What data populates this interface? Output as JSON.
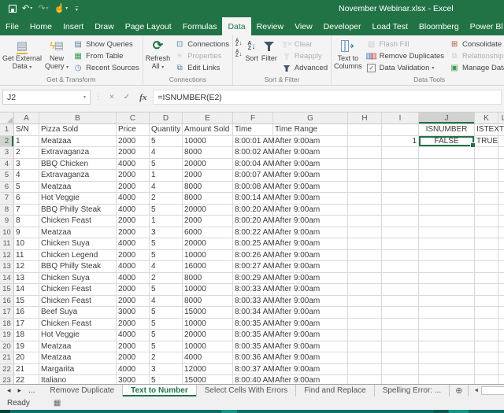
{
  "title_bar": {
    "title": "November Webinar.xlsx - Excel"
  },
  "icons": {
    "undo": "↶",
    "redo": "↷",
    "touch_mode": "☝",
    "caret_down": "▾",
    "letter_a": "A",
    "letter_z": "Z",
    "arrow_down": "↓",
    "get_external": "▤",
    "new_query_bolt": "ϟ",
    "new_query_table": "▤",
    "show_queries": "▤",
    "from_table": "▦",
    "recent_sources": "◷",
    "refresh": "⟳",
    "connections": "⊡",
    "properties": "≡",
    "edit_links": "⧉",
    "flash_fill": "▧",
    "remove_dup_a": "▥",
    "remove_dup_b": "▥",
    "check": "✓",
    "consolidate": "⊞",
    "relationships": "⧉",
    "manage_data_model": "▣",
    "cancel": "×",
    "enter": "✓",
    "fx": "fx",
    "ellipsis_v": "⋮",
    "nav_left": "◂",
    "nav_right": "▸",
    "tabs_more": "...",
    "add_sheet": "⊕",
    "scroll_left": "◄",
    "macro": "▦"
  },
  "ribbon_tabs": {
    "file": "File",
    "tabs": [
      "Home",
      "Insert",
      "Draw",
      "Page Layout",
      "Formulas",
      "Data",
      "Review",
      "View",
      "Developer",
      "Load Test",
      "Bloomberg",
      "Power Bl"
    ],
    "active": "Data"
  },
  "ribbon": {
    "groups": [
      {
        "label": "Get & Transform",
        "big": [
          {
            "name": "get-external-data",
            "line1": "Get External",
            "line2": "Data",
            "caret": true,
            "icon": "get_external"
          },
          {
            "name": "new-query",
            "line1": "New",
            "line2": "Query",
            "caret": true,
            "icon": "new_query"
          }
        ],
        "small": [
          {
            "name": "show-queries",
            "label": "Show Queries",
            "icon": "show_queries"
          },
          {
            "name": "from-table",
            "label": "From Table",
            "icon": "from_table"
          },
          {
            "name": "recent-sources",
            "label": "Recent Sources",
            "icon": "recent_sources"
          }
        ]
      },
      {
        "label": "Connections",
        "big": [
          {
            "name": "refresh-all",
            "line1": "Refresh",
            "line2": "All",
            "caret": true,
            "icon": "refresh"
          }
        ],
        "small": [
          {
            "name": "connections",
            "label": "Connections",
            "icon": "connections"
          },
          {
            "name": "properties",
            "label": "Properties",
            "icon": "properties",
            "disabled": true
          },
          {
            "name": "edit-links",
            "label": "Edit Links",
            "icon": "edit_links"
          }
        ]
      },
      {
        "label": "Sort & Filter",
        "az": true,
        "big": [
          {
            "name": "sort",
            "line1": "Sort",
            "icon": "sort_big"
          },
          {
            "name": "filter",
            "line1": "Filter",
            "icon": "funnel"
          }
        ],
        "small": [
          {
            "name": "clear-filter",
            "label": "Clear",
            "icon": "funnel_x",
            "disabled": true
          },
          {
            "name": "reapply-filter",
            "label": "Reapply",
            "icon": "funnel_r",
            "disabled": true
          },
          {
            "name": "advanced-filter",
            "label": "Advanced",
            "icon": "funnel_a"
          }
        ]
      },
      {
        "label": "Data Tools",
        "big": [
          {
            "name": "text-to-columns",
            "line1": "Text to",
            "line2": "Columns",
            "icon": "ttc"
          }
        ],
        "small": [
          {
            "name": "flash-fill",
            "label": "Flash Fill",
            "icon": "flash_fill",
            "disabled": true
          },
          {
            "name": "remove-duplicates",
            "label": "Remove Duplicates",
            "icon": "remove_duplicates"
          },
          {
            "name": "data-validation",
            "label": "Data Validation",
            "icon": "data_validation",
            "caret": true
          }
        ],
        "small2": [
          {
            "name": "consolidate",
            "label": "Consolidate",
            "icon": "consolidate"
          },
          {
            "name": "relationships",
            "label": "Relationships",
            "icon": "relationships",
            "disabled": true
          },
          {
            "name": "manage-data-model",
            "label": "Manage Data Mod",
            "icon": "manage_data_model"
          }
        ]
      }
    ]
  },
  "formula_bar": {
    "name_box": "J2",
    "formula": "=ISNUMBER(E2)"
  },
  "grid": {
    "column_letters": [
      "A",
      "B",
      "C",
      "D",
      "E",
      "F",
      "G",
      "H",
      "I",
      "J",
      "K",
      "L"
    ],
    "selected_column": "J",
    "selected_row_number": 2,
    "selected_cell_ref": "J2",
    "header_row": [
      "S/N",
      "Pizza Sold",
      "Price",
      "Quantity",
      "Amount Sold",
      "Time",
      "Time Range",
      "",
      "",
      "ISNUMBER",
      "ISTEXT"
    ],
    "rows": [
      [
        "1",
        "Meatzaa",
        "2000",
        "5",
        "10000",
        "8:00:01 AM",
        "After 9:00am",
        "",
        "1",
        "FALSE",
        "TRUE"
      ],
      [
        "2",
        "Extravaganza",
        "2000",
        "4",
        "8000",
        "8:00:02 AM",
        "After 9:00am",
        "",
        "",
        "",
        ""
      ],
      [
        "3",
        "BBQ Chicken",
        "4000",
        "5",
        "20000",
        "8:00:04 AM",
        "After 9:00am",
        "",
        "",
        "",
        ""
      ],
      [
        "4",
        "Extravaganza",
        "2000",
        "1",
        "2000",
        "8:00:07 AM",
        "After 9:00am",
        "",
        "",
        "",
        ""
      ],
      [
        "5",
        "Meatzaa",
        "2000",
        "4",
        "8000",
        "8:00:08 AM",
        "After 9:00am",
        "",
        "",
        "",
        ""
      ],
      [
        "6",
        "Hot Veggie",
        "4000",
        "2",
        "8000",
        "8:00:14 AM",
        "After 9:00am",
        "",
        "",
        "",
        ""
      ],
      [
        "7",
        "BBQ Philly Steak",
        "4000",
        "5",
        "20000",
        "8:00:20 AM",
        "After 9:00am",
        "",
        "",
        "",
        ""
      ],
      [
        "8",
        "Chicken Feast",
        "2000",
        "1",
        "2000",
        "8:00:20 AM",
        "After 9:00am",
        "",
        "",
        "",
        ""
      ],
      [
        "9",
        "Meatzaa",
        "2000",
        "3",
        "6000",
        "8:00:22 AM",
        "After 9:00am",
        "",
        "",
        "",
        ""
      ],
      [
        "10",
        "Chicken Suya",
        "4000",
        "5",
        "20000",
        "8:00:25 AM",
        "After 9:00am",
        "",
        "",
        "",
        ""
      ],
      [
        "11",
        "Chicken Legend",
        "2000",
        "5",
        "10000",
        "8:00:26 AM",
        "After 9:00am",
        "",
        "",
        "",
        ""
      ],
      [
        "12",
        "BBQ Philly Steak",
        "4000",
        "4",
        "16000",
        "8:00:27 AM",
        "After 9:00am",
        "",
        "",
        "",
        ""
      ],
      [
        "13",
        "Chicken Suya",
        "4000",
        "2",
        "8000",
        "8:00:29 AM",
        "After 9:00am",
        "",
        "",
        "",
        ""
      ],
      [
        "14",
        "Chicken Feast",
        "2000",
        "5",
        "10000",
        "8:00:33 AM",
        "After 9:00am",
        "",
        "",
        "",
        ""
      ],
      [
        "15",
        "Chicken Feast",
        "2000",
        "4",
        "8000",
        "8:00:33 AM",
        "After 9:00am",
        "",
        "",
        "",
        ""
      ],
      [
        "16",
        "Beef Suya",
        "3000",
        "5",
        "15000",
        "8:00:34 AM",
        "After 9:00am",
        "",
        "",
        "",
        ""
      ],
      [
        "17",
        "Chicken Feast",
        "2000",
        "5",
        "10000",
        "8:00:35 AM",
        "After 9:00am",
        "",
        "",
        "",
        ""
      ],
      [
        "18",
        "Hot Veggie",
        "4000",
        "5",
        "20000",
        "8:00:35 AM",
        "After 9:00am",
        "",
        "",
        "",
        ""
      ],
      [
        "19",
        "Meatzaa",
        "2000",
        "5",
        "10000",
        "8:00:35 AM",
        "After 9:00am",
        "",
        "",
        "",
        ""
      ],
      [
        "20",
        "Meatzaa",
        "2000",
        "2",
        "4000",
        "8:00:36 AM",
        "After 9:00am",
        "",
        "",
        "",
        ""
      ],
      [
        "21",
        "Margarita",
        "4000",
        "3",
        "12000",
        "8:00:37 AM",
        "After 9:00am",
        "",
        "",
        "",
        ""
      ],
      [
        "22",
        "Italiano",
        "3000",
        "5",
        "15000",
        "8:00:40 AM",
        "After 9:00am",
        "",
        "",
        "",
        ""
      ]
    ]
  },
  "sheet_tabs": {
    "tabs": [
      "Remove Duplicate",
      "Text to Number",
      "Select Cells With Errors",
      "Find and Replace",
      "Spelling Error: ..."
    ],
    "active": "Text to Number"
  },
  "status_bar": {
    "status": "Ready"
  },
  "colors": {
    "excel_green": "#217346",
    "funnel": "#44546a",
    "teal_strip": "#0f6f6a"
  }
}
